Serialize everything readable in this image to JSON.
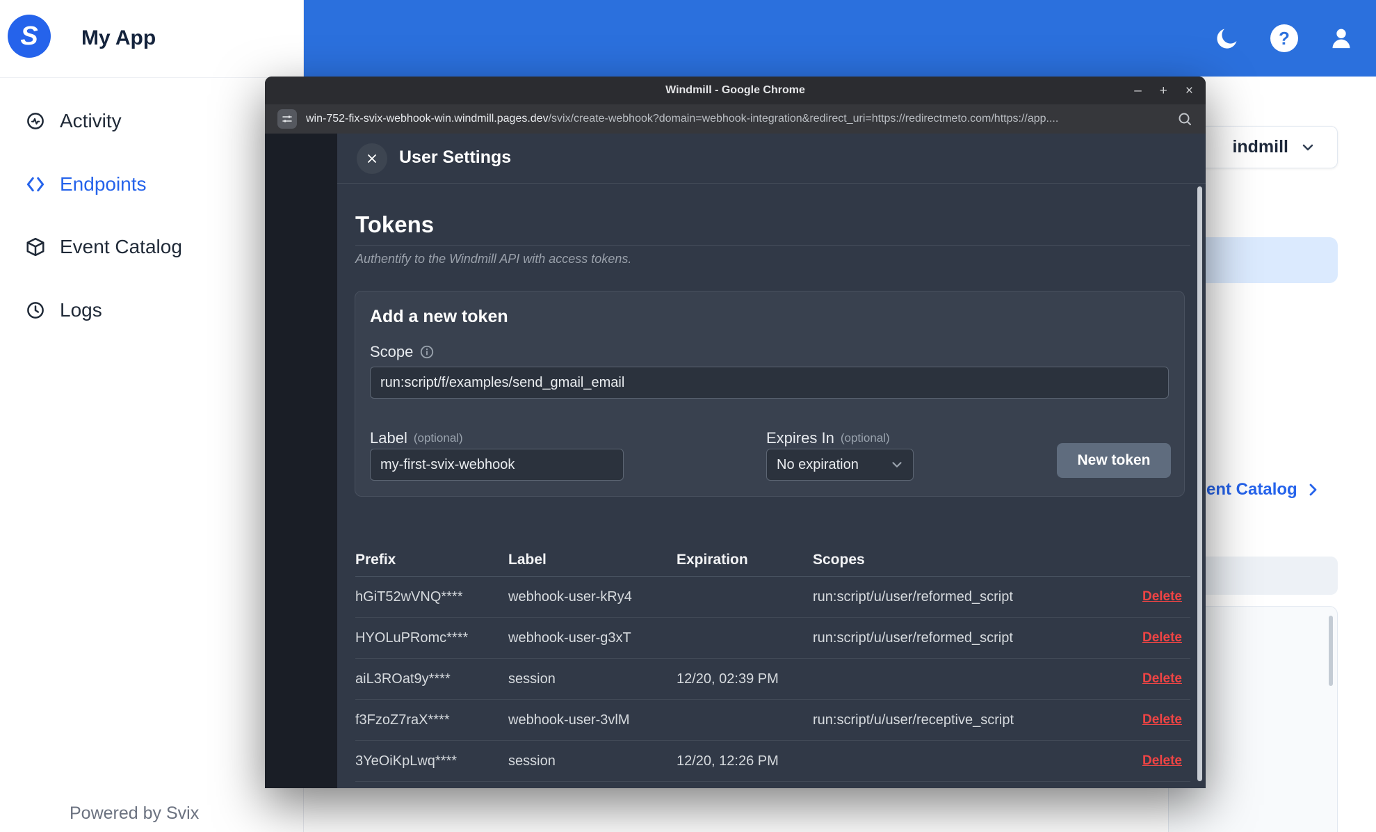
{
  "colors": {
    "accent": "#2563eb",
    "topbar_blue": "#2b70dd",
    "delete_red": "#ef4444",
    "drawer_bg": "#313947"
  },
  "app": {
    "name": "My App",
    "sidebar": {
      "items": [
        {
          "label": "Activity",
          "icon": "activity-icon",
          "active": false
        },
        {
          "label": "Endpoints",
          "icon": "code-icon",
          "active": true
        },
        {
          "label": "Event Catalog",
          "icon": "cube-icon",
          "active": false
        },
        {
          "label": "Logs",
          "icon": "history-icon",
          "active": false
        }
      ],
      "footer": "Powered by Svix"
    },
    "background": {
      "dropdown_label": "indmill",
      "catalog_link": "ent Catalog"
    }
  },
  "chrome": {
    "title": "Windmill - Google Chrome",
    "controls": {
      "minimize": "–",
      "maximize": "+",
      "close": "×"
    },
    "url_domain": "win-752-fix-svix-webhook-win.windmill.pages.dev",
    "url_path": "/svix/create-webhook?domain=webhook-integration&redirect_uri=https://redirectmeto.com/https://app...."
  },
  "settings": {
    "title": "User Settings",
    "tokens": {
      "heading": "Tokens",
      "subtitle": "Authentify to the Windmill API with access tokens.",
      "add_panel": {
        "title": "Add a new token",
        "scope_label": "Scope",
        "scope_value": "run:script/f/examples/send_gmail_email",
        "label_label": "Label",
        "optional": "(optional)",
        "label_value": "my-first-svix-webhook",
        "expires_label": "Expires In",
        "expires_value": "No expiration",
        "button": "New token"
      },
      "table": {
        "headers": [
          "Prefix",
          "Label",
          "Expiration",
          "Scopes"
        ],
        "delete_label": "Delete",
        "rows": [
          {
            "prefix": "hGiT52wVNQ****",
            "label": "webhook-user-kRy4",
            "expiration": "",
            "scopes": "run:script/u/user/reformed_script"
          },
          {
            "prefix": "HYOLuPRomc****",
            "label": "webhook-user-g3xT",
            "expiration": "",
            "scopes": "run:script/u/user/reformed_script"
          },
          {
            "prefix": "aiL3ROat9y****",
            "label": "session",
            "expiration": "12/20, 02:39 PM",
            "scopes": ""
          },
          {
            "prefix": "f3FzoZ7raX****",
            "label": "webhook-user-3vlM",
            "expiration": "",
            "scopes": "run:script/u/user/receptive_script"
          },
          {
            "prefix": "3YeOiKpLwq****",
            "label": "session",
            "expiration": "12/20, 12:26 PM",
            "scopes": ""
          }
        ]
      }
    }
  }
}
